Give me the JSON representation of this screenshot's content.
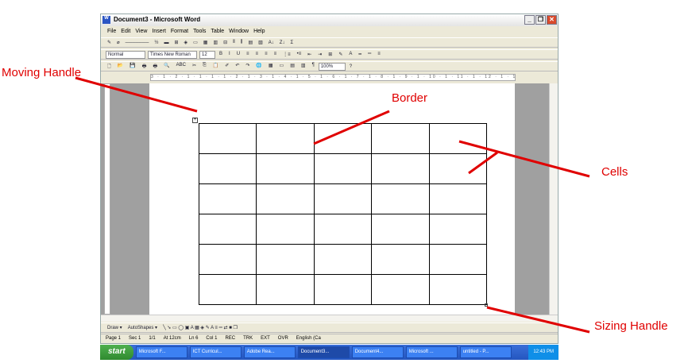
{
  "window": {
    "title": "Document3 - Microsoft Word",
    "min": "_",
    "max": "❐",
    "close": "✕"
  },
  "menu": [
    "File",
    "Edit",
    "View",
    "Insert",
    "Format",
    "Tools",
    "Table",
    "Window",
    "Help"
  ],
  "toolbar1": [
    "✎",
    "⌀",
    "───────",
    "½",
    "▬",
    "⊞",
    "◈",
    "▭",
    "▦",
    "▥",
    "⊟",
    "⫴",
    "⫼",
    "▤",
    "▧",
    "A↓",
    "Z↓",
    "Σ"
  ],
  "formatting": {
    "style": "Normal",
    "font": "Times New Roman",
    "size": "12",
    "buttons": [
      "B",
      "I",
      "U",
      "≡",
      "≡",
      "≡",
      "≡",
      "⋮≡",
      "•≡",
      "⇤",
      "⇥",
      "⊞",
      "✎",
      "A",
      "━",
      "═",
      "≡"
    ]
  },
  "standard": {
    "buttons": [
      "🗋",
      "📂",
      "💾",
      "🖶",
      "🖶",
      "🔍",
      "ABC",
      "✂",
      "⎘",
      "📋",
      "✐",
      "↶",
      "↷",
      "🌐",
      "▦",
      "▭",
      "▤",
      "▥",
      "¶"
    ],
    "zoom": "100%",
    "help": "?"
  },
  "ruler": "3 · 1 · 2 · 1 · 1 · 1 · 1 · 2 · 1 · 3 · 1 · 4 · 1 · 5 · 1 · 6 · 1 · 7 · 1 · 8 · 1 · 9 · 1 · 10 · 1 · 11 · 1 · 12 · 1 · 13 · 1 · 14 · 1 · 15 · 1 · 16 · 1 · 17 · 1 · 18",
  "table": {
    "rows": 6,
    "cols": 5
  },
  "draw_toolbar": {
    "draw": "Draw ▾",
    "autoshapes": "AutoShapes ▾"
  },
  "status": [
    "Page 1",
    "Sec 1",
    "1/1",
    "At 12cm",
    "Ln 6",
    "Col 1",
    "REC",
    "TRK",
    "EXT",
    "OVR",
    "English (Ca"
  ],
  "taskbar": {
    "start": "start",
    "tasks": [
      "Microsoft F...",
      "ICT Curricul...",
      "Adobe Rea...",
      "Document3...",
      "Document4...",
      "Microsoft ...",
      "untitled - P..."
    ],
    "clock": "12:43 PM"
  },
  "annotations": {
    "moving_handle": "Moving Handle",
    "border": "Border",
    "cells": "Cells",
    "sizing_handle": "Sizing Handle"
  },
  "colors": {
    "annotation": "#e00000"
  }
}
